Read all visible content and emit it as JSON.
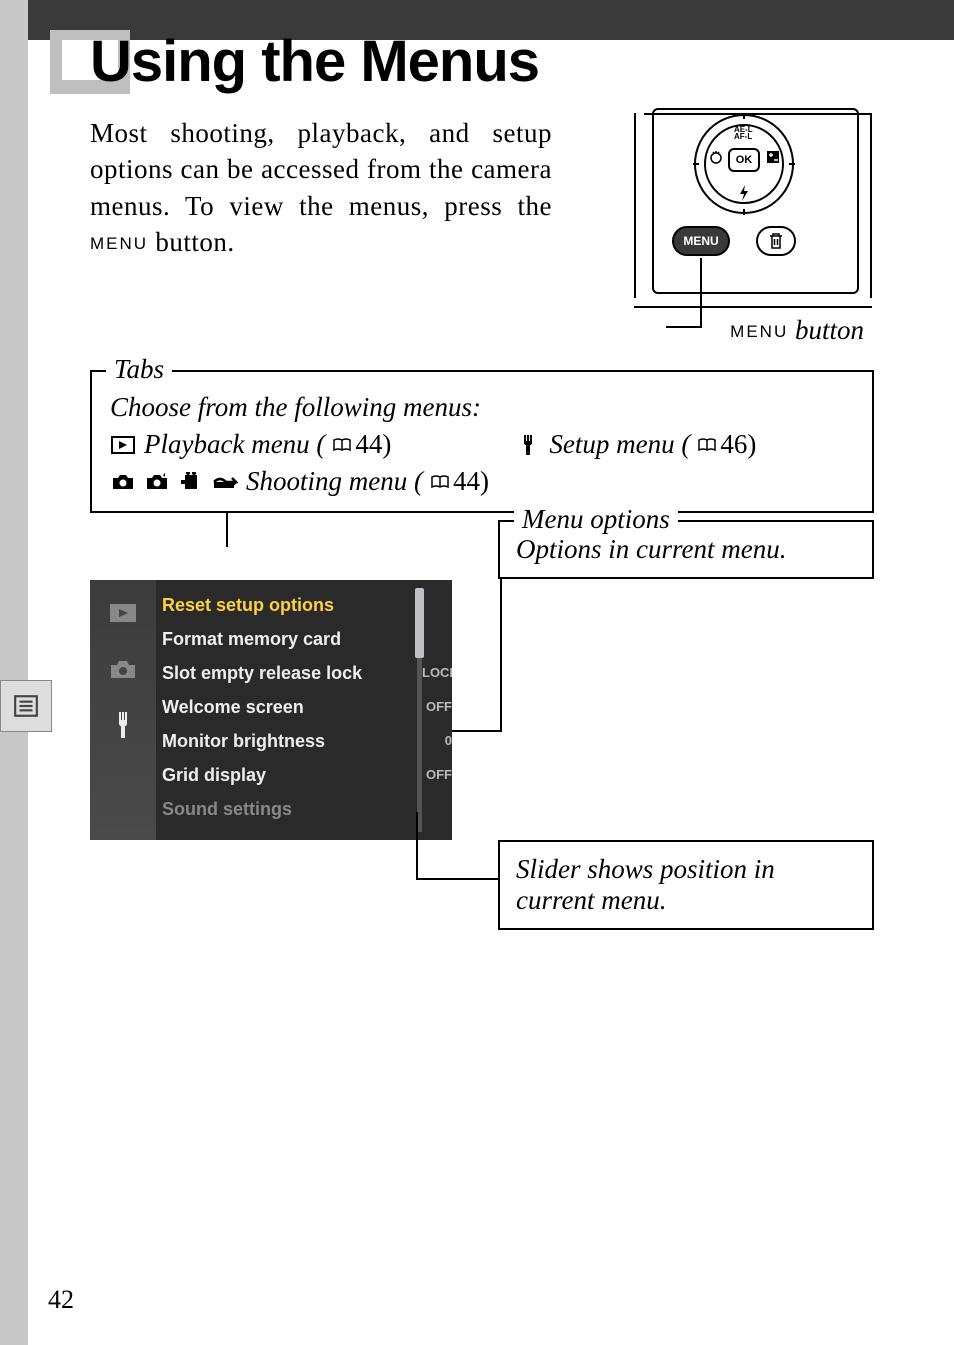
{
  "page_number": "42",
  "title": "Using the Menus",
  "intro_text": "Most shooting, playback, and setup options can be accessed from the camera menus. To view the menus, press the ",
  "menu_word": "MENU",
  "intro_tail": " button.",
  "menu_button_caption_tail": " button",
  "tabs": {
    "legend": "Tabs",
    "lead": "Choose from the following menus:",
    "playback": "Playback menu (",
    "playback_page": "44)",
    "setup": "Setup menu (",
    "setup_page": "46)",
    "shooting": "Shooting menu (",
    "shooting_page": "44)"
  },
  "options": {
    "legend": "Menu options",
    "text": "Options in current menu."
  },
  "slider": {
    "text": "Slider shows position in current menu."
  },
  "dial": {
    "ok": "OK",
    "top": "AE-L\nAF-L"
  },
  "camera_buttons": {
    "menu": "MENU"
  },
  "lcd": {
    "items": [
      {
        "label": "Reset setup options",
        "val": ""
      },
      {
        "label": "Format memory card",
        "val": ""
      },
      {
        "label": "Slot empty release lock",
        "val": "LOCK"
      },
      {
        "label": "Welcome screen",
        "val": "OFF"
      },
      {
        "label": "Monitor brightness",
        "val": "0"
      },
      {
        "label": "Grid display",
        "val": "OFF"
      },
      {
        "label": "Sound settings",
        "val": ""
      }
    ]
  }
}
